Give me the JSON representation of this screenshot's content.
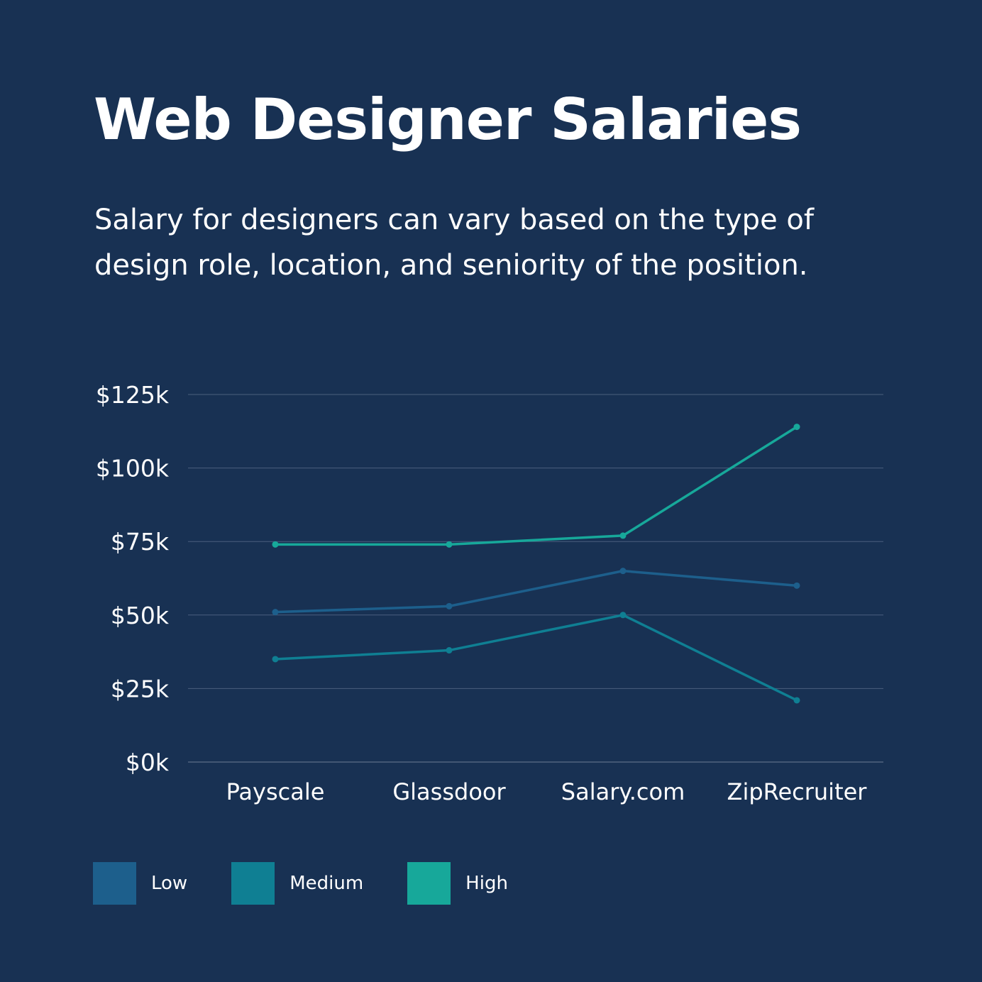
{
  "title": "Web Designer Salaries",
  "subtitle": "Salary for designers can vary based on the type of design role, location, and seniority of the position.",
  "colors": {
    "background": "#183153",
    "grid": "#4a5f7e",
    "low": "#1d5f8c",
    "medium": "#0f7f93",
    "high": "#17a89a"
  },
  "chart_data": {
    "type": "line",
    "title": "Web Designer Salaries",
    "xlabel": "",
    "ylabel": "",
    "categories": [
      "Payscale",
      "Glassdoor",
      "Salary.com",
      "ZipRecruiter"
    ],
    "yticks": [
      0,
      25,
      50,
      75,
      100,
      125
    ],
    "ytick_labels": [
      "$0k",
      "$25k",
      "$50k",
      "$75k",
      "$100k",
      "$125k"
    ],
    "ylim": [
      0,
      125
    ],
    "grid": true,
    "legend_position": "bottom-left",
    "series": [
      {
        "name": "Low",
        "color": "#1d5f8c",
        "values": [
          51,
          53,
          65,
          60
        ]
      },
      {
        "name": "Medium",
        "color": "#0f7f93",
        "values": [
          35,
          38,
          50,
          21
        ]
      },
      {
        "name": "High",
        "color": "#17a89a",
        "values": [
          74,
          74,
          77,
          114
        ]
      }
    ]
  },
  "legend": [
    {
      "label": "Low",
      "color": "#1d5f8c"
    },
    {
      "label": "Medium",
      "color": "#0f7f93"
    },
    {
      "label": "High",
      "color": "#17a89a"
    }
  ]
}
